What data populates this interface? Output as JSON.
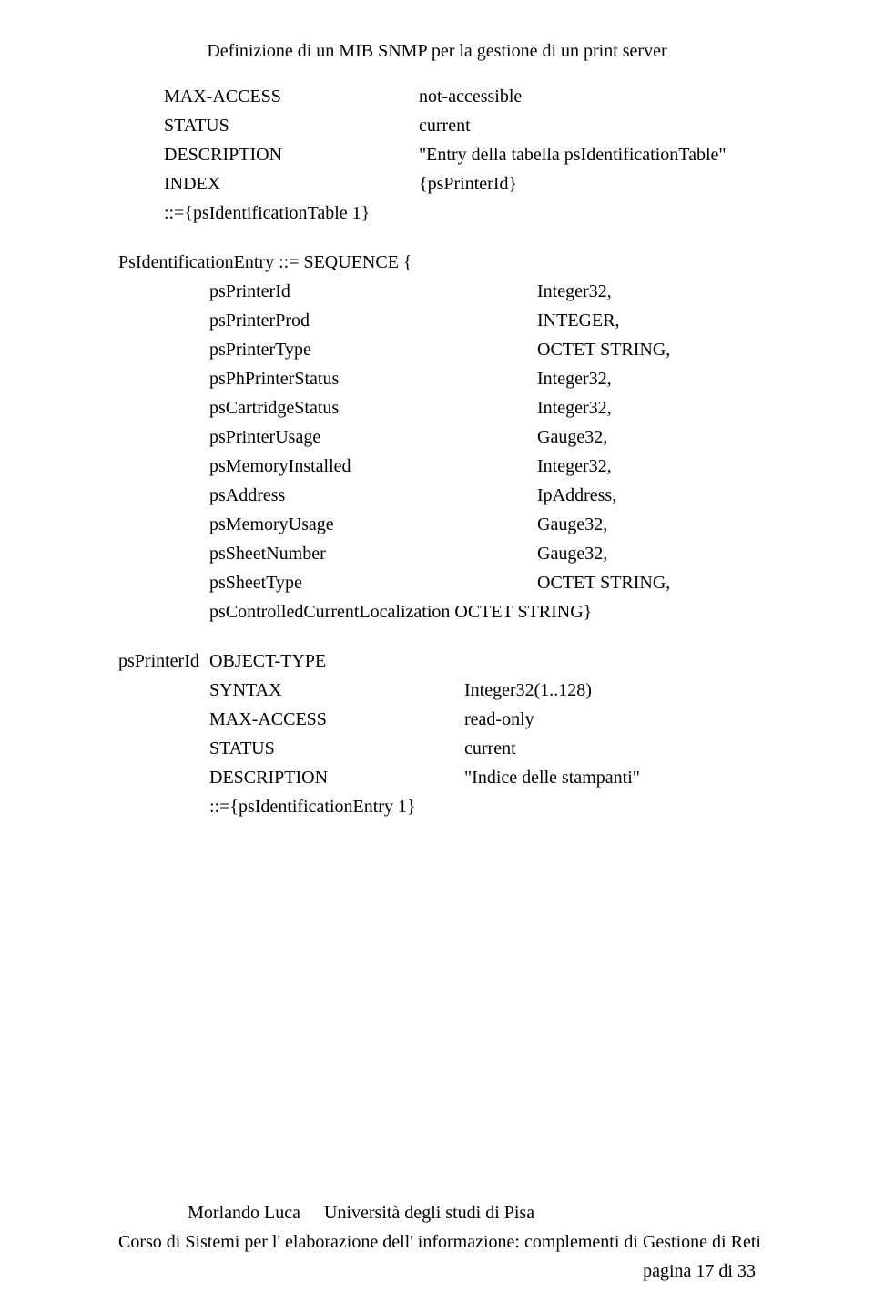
{
  "header": {
    "title": "Definizione di un MIB SNMP per la gestione di un print server"
  },
  "block1": {
    "rows": [
      {
        "k": "MAX-ACCESS",
        "v": "not-accessible"
      },
      {
        "k": "STATUS",
        "v": "current"
      },
      {
        "k": "DESCRIPTION",
        "v": "\"Entry della tabella psIdentificationTable\""
      },
      {
        "k": "INDEX",
        "v": "{psPrinterId}"
      }
    ],
    "tail": "::={psIdentificationTable 1}"
  },
  "seq": {
    "open": "PsIdentificationEntry ::= SEQUENCE {",
    "rows": [
      {
        "k": "psPrinterId",
        "v": "Integer32,"
      },
      {
        "k": "psPrinterProd",
        "v": "INTEGER,"
      },
      {
        "k": "psPrinterType",
        "v": "OCTET STRING,"
      },
      {
        "k": "psPhPrinterStatus",
        "v": "Integer32,"
      },
      {
        "k": "psCartridgeStatus",
        "v": "Integer32,"
      },
      {
        "k": "psPrinterUsage",
        "v": "Gauge32,"
      },
      {
        "k": "psMemoryInstalled",
        "v": "Integer32,"
      },
      {
        "k": "psAddress",
        "v": "IpAddress,"
      },
      {
        "k": "psMemoryUsage",
        "v": "Gauge32,"
      },
      {
        "k": "psSheetNumber",
        "v": "Gauge32,"
      },
      {
        "k": "psSheetType",
        "v": "OCTET STRING,"
      }
    ],
    "tail": "psControlledCurrentLocalization OCTET STRING}"
  },
  "block2": {
    "open_left": "psPrinterId",
    "open_right": "OBJECT-TYPE",
    "rows": [
      {
        "k": "SYNTAX",
        "v": "Integer32(1..128)"
      },
      {
        "k": "MAX-ACCESS",
        "v": "read-only"
      },
      {
        "k": "STATUS",
        "v": "current"
      },
      {
        "k": "DESCRIPTION",
        "v": "\"Indice delle stampanti\""
      }
    ],
    "tail": "::={psIdentificationEntry 1}"
  },
  "footer": {
    "l1": "Morlando Luca",
    "r1": "Università degli studi di Pisa",
    "single": "Corso di Sistemi per l' elaborazione dell' informazione: complementi di Gestione di Reti",
    "page": "pagina 17 di 33"
  }
}
